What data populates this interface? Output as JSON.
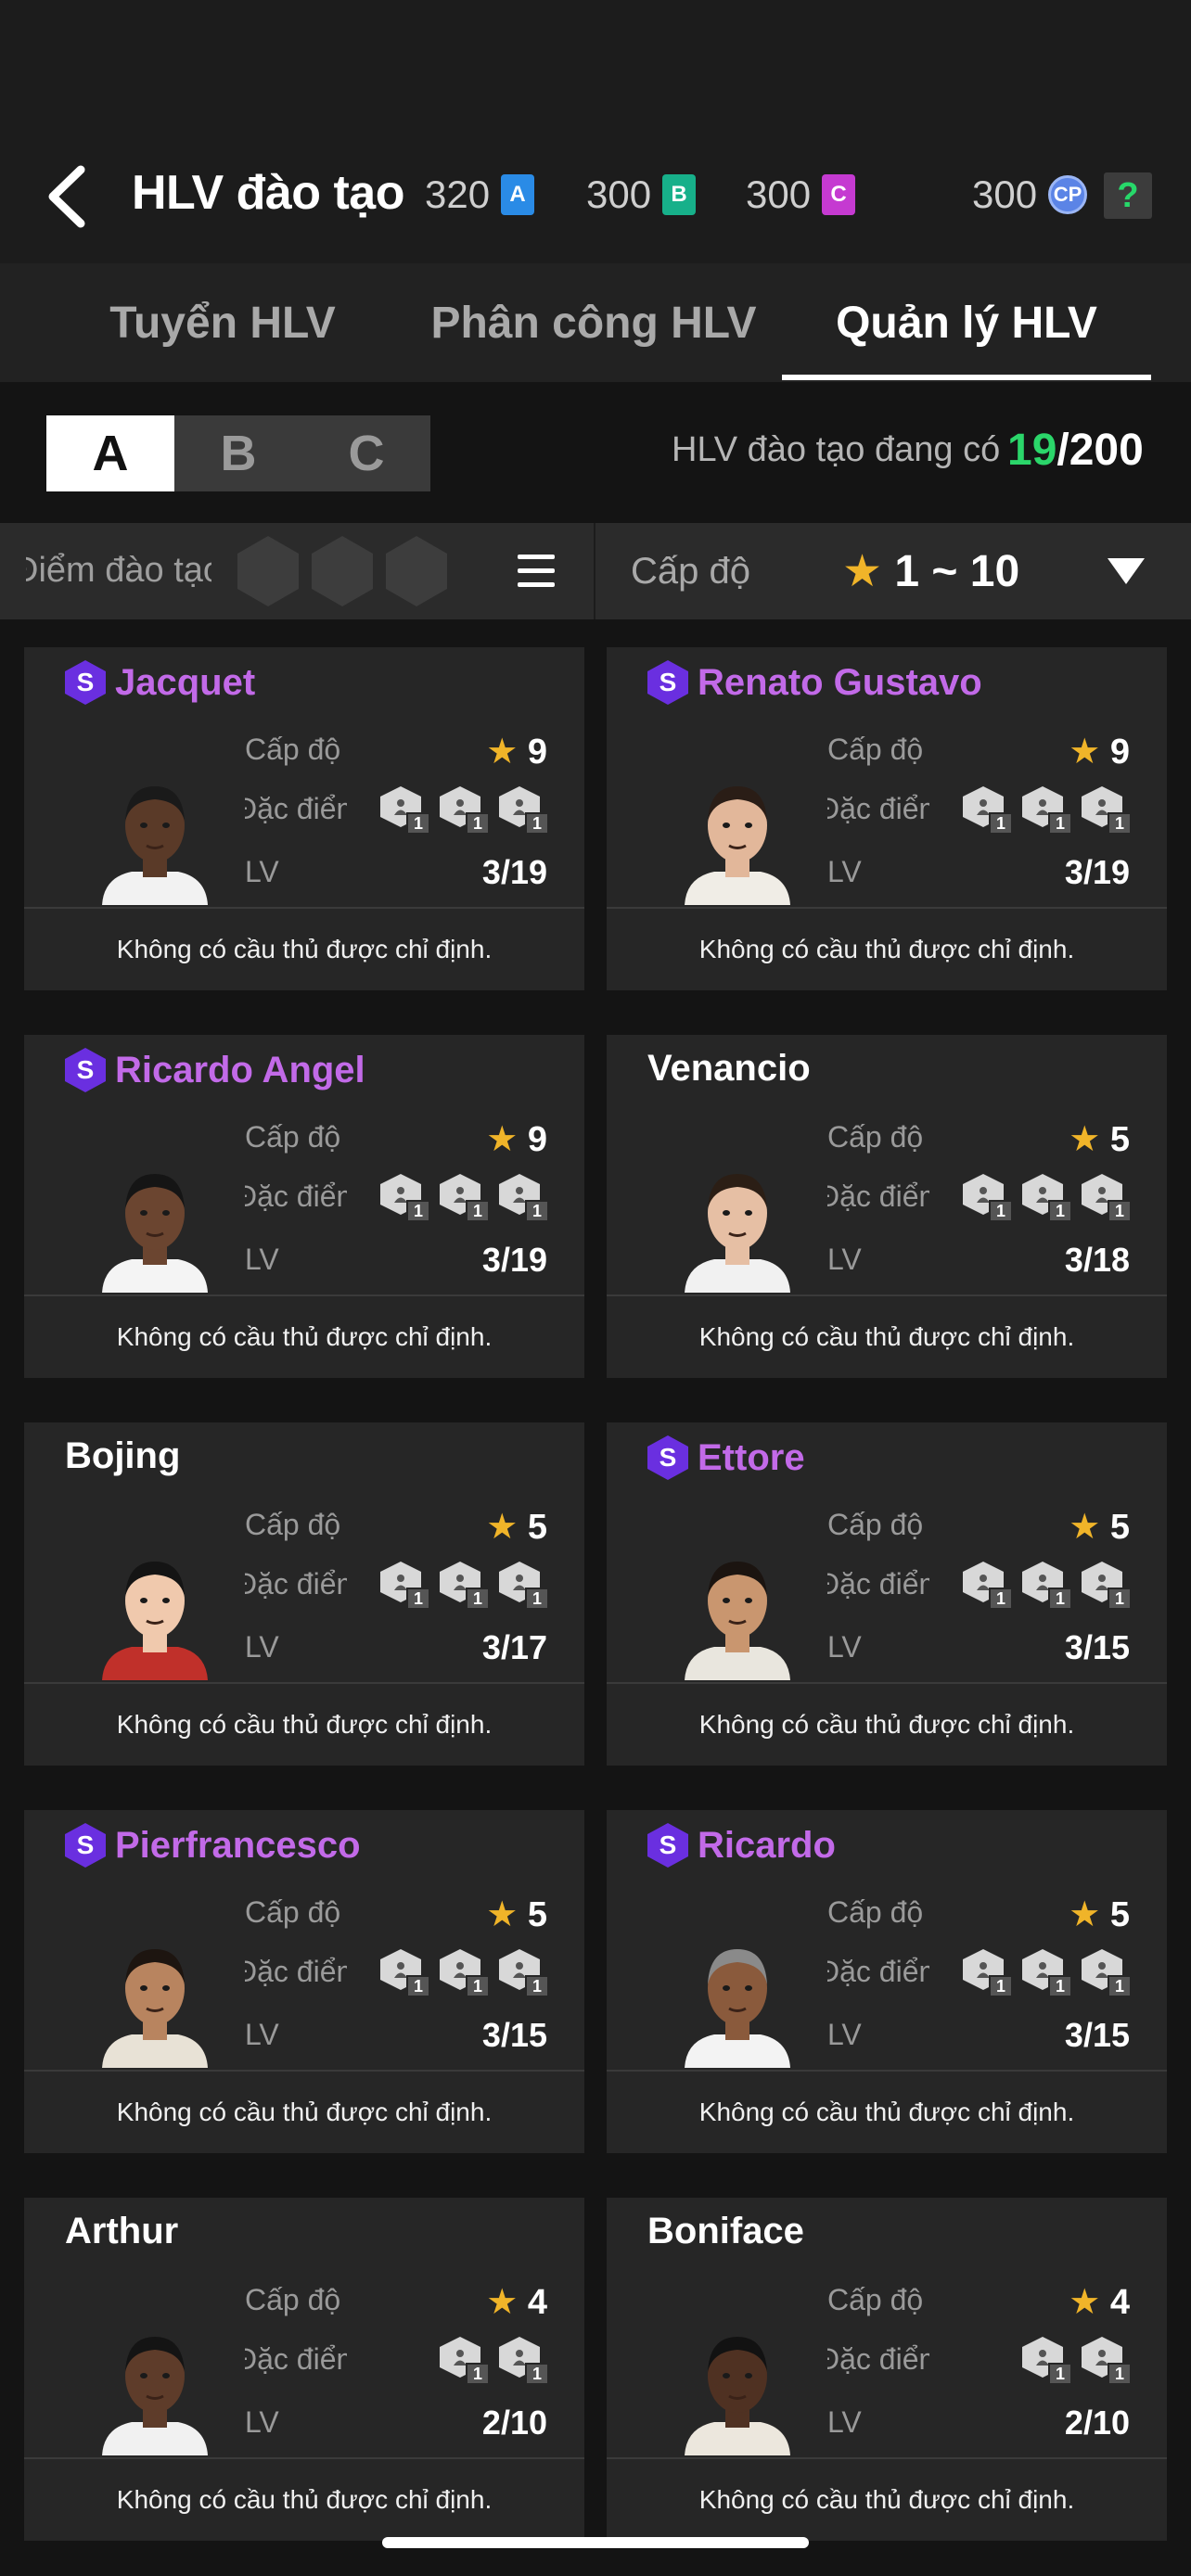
{
  "header": {
    "title": "HLV đào tạo",
    "currencies": [
      {
        "amount": "320",
        "tag": "A",
        "color": "#2a8be6"
      },
      {
        "amount": "300",
        "tag": "B",
        "color": "#17b08a"
      },
      {
        "amount": "300",
        "tag": "C",
        "color": "#c53ad1"
      },
      {
        "amount": "300",
        "tag": "CP",
        "color": "#5b84e6"
      }
    ],
    "help_label": "?"
  },
  "tabs": [
    {
      "label": "Tuyển HLV",
      "active": false
    },
    {
      "label": "Phân công HLV",
      "active": false
    },
    {
      "label": "Quản lý HLV",
      "active": true
    }
  ],
  "groups": {
    "options": [
      "A",
      "B",
      "C"
    ],
    "selected": "A"
  },
  "coach_count": {
    "label": "HLV đào tạo đang có",
    "current": "19",
    "max": "/200"
  },
  "filter": {
    "training_points_label": "Điểm đào tạo",
    "level_label": "Cấp độ",
    "level_range": "1 ~ 10",
    "star": "★"
  },
  "card_labels": {
    "level": "Cấp độ",
    "traits": "Đặc điểm",
    "lv": "LV",
    "note": "Không có cầu thủ được chỉ định.",
    "special_badge": "S"
  },
  "coaches": [
    {
      "name": "Jacquet",
      "special": true,
      "level": "9",
      "lv": "3/19",
      "traits": [
        "1",
        "1",
        "1"
      ],
      "skin": "#5a3a28",
      "shirt": "#f2f2f2",
      "hair": "#1a1a1a"
    },
    {
      "name": "Renato Gustavo",
      "special": true,
      "level": "9",
      "lv": "3/19",
      "traits": [
        "1",
        "1",
        "1"
      ],
      "skin": "#e2b79a",
      "shirt": "#f0ede6",
      "hair": "#2a1d16"
    },
    {
      "name": "Ricardo Angel",
      "special": true,
      "level": "9",
      "lv": "3/19",
      "traits": [
        "1",
        "1",
        "1"
      ],
      "skin": "#6b4530",
      "shirt": "#f4f4f4",
      "hair": "#151515"
    },
    {
      "name": "Venancio",
      "special": false,
      "level": "5",
      "lv": "3/18",
      "traits": [
        "1",
        "1",
        "1"
      ],
      "skin": "#e6bfa4",
      "shirt": "#f1f1f1",
      "hair": "#2b1e15"
    },
    {
      "name": "Bojing",
      "special": false,
      "level": "5",
      "lv": "3/17",
      "traits": [
        "1",
        "1",
        "1"
      ],
      "skin": "#f0c9ad",
      "shirt": "#c0302a",
      "hair": "#141414"
    },
    {
      "name": "Ettore",
      "special": true,
      "level": "5",
      "lv": "3/15",
      "traits": [
        "1",
        "1",
        "1"
      ],
      "skin": "#c9966f",
      "shirt": "#e9e6de",
      "hair": "#1b1410"
    },
    {
      "name": "Pierfrancesco",
      "special": true,
      "level": "5",
      "lv": "3/15",
      "traits": [
        "1",
        "1",
        "1"
      ],
      "skin": "#b8845f",
      "shirt": "#e8e2d6",
      "hair": "#1d1510"
    },
    {
      "name": "Ricardo",
      "special": true,
      "level": "5",
      "lv": "3/15",
      "traits": [
        "1",
        "1",
        "1"
      ],
      "skin": "#8a5a3c",
      "shirt": "#f3f3f3",
      "hair": "#8a8a8a"
    },
    {
      "name": "Arthur",
      "special": false,
      "level": "4",
      "lv": "2/10",
      "traits": [
        "1",
        "1"
      ],
      "skin": "#5e3c2a",
      "shirt": "#f1f1f1",
      "hair": "#141414"
    },
    {
      "name": "Boniface",
      "special": false,
      "level": "4",
      "lv": "2/10",
      "traits": [
        "1",
        "1"
      ],
      "skin": "#4f3122",
      "shirt": "#ece7dd",
      "hair": "#121212"
    }
  ]
}
